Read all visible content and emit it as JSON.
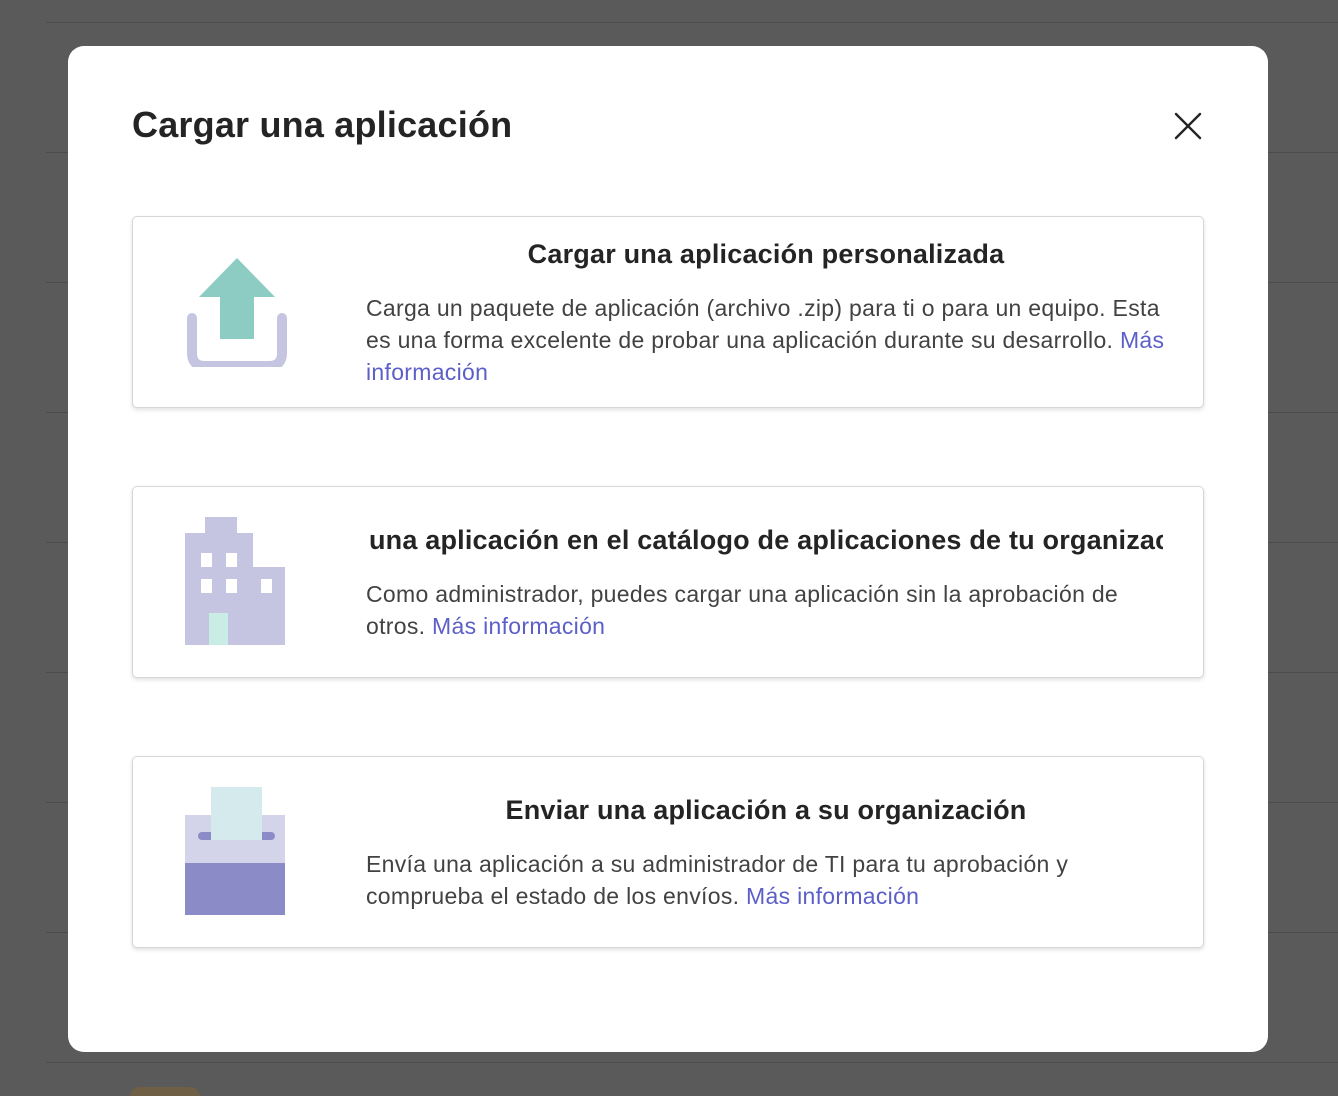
{
  "dialog": {
    "title": "Cargar una aplicación",
    "close_label": "Cerrar"
  },
  "options": [
    {
      "title": "Cargar una aplicación personalizada",
      "description": "Carga un paquete de aplicación (archivo .zip) para ti o para un equipo. Esta es una forma excelente de probar una aplicación durante su desarrollo.",
      "link": "Más información",
      "icon": "upload-icon"
    },
    {
      "title": "Cargar una aplicación en el catálogo de aplicaciones de tu organización",
      "description": "Como administrador, puedes cargar una aplicación sin la aprobación de otros.",
      "link": "Más información",
      "icon": "building-icon"
    },
    {
      "title": "Enviar una aplicación a su organización",
      "description": "Envía una aplicación a su administrador de TI para tu aprobación y comprueba el estado de los envíos.",
      "link": "Más información",
      "icon": "submit-box-icon"
    }
  ],
  "colors": {
    "accent_link": "#5b5fc7",
    "icon_teal": "#8dccc3",
    "icon_lavender": "#c5c5e1",
    "icon_purple": "#8b8cc7",
    "icon_light_blue": "#d4eaec"
  }
}
